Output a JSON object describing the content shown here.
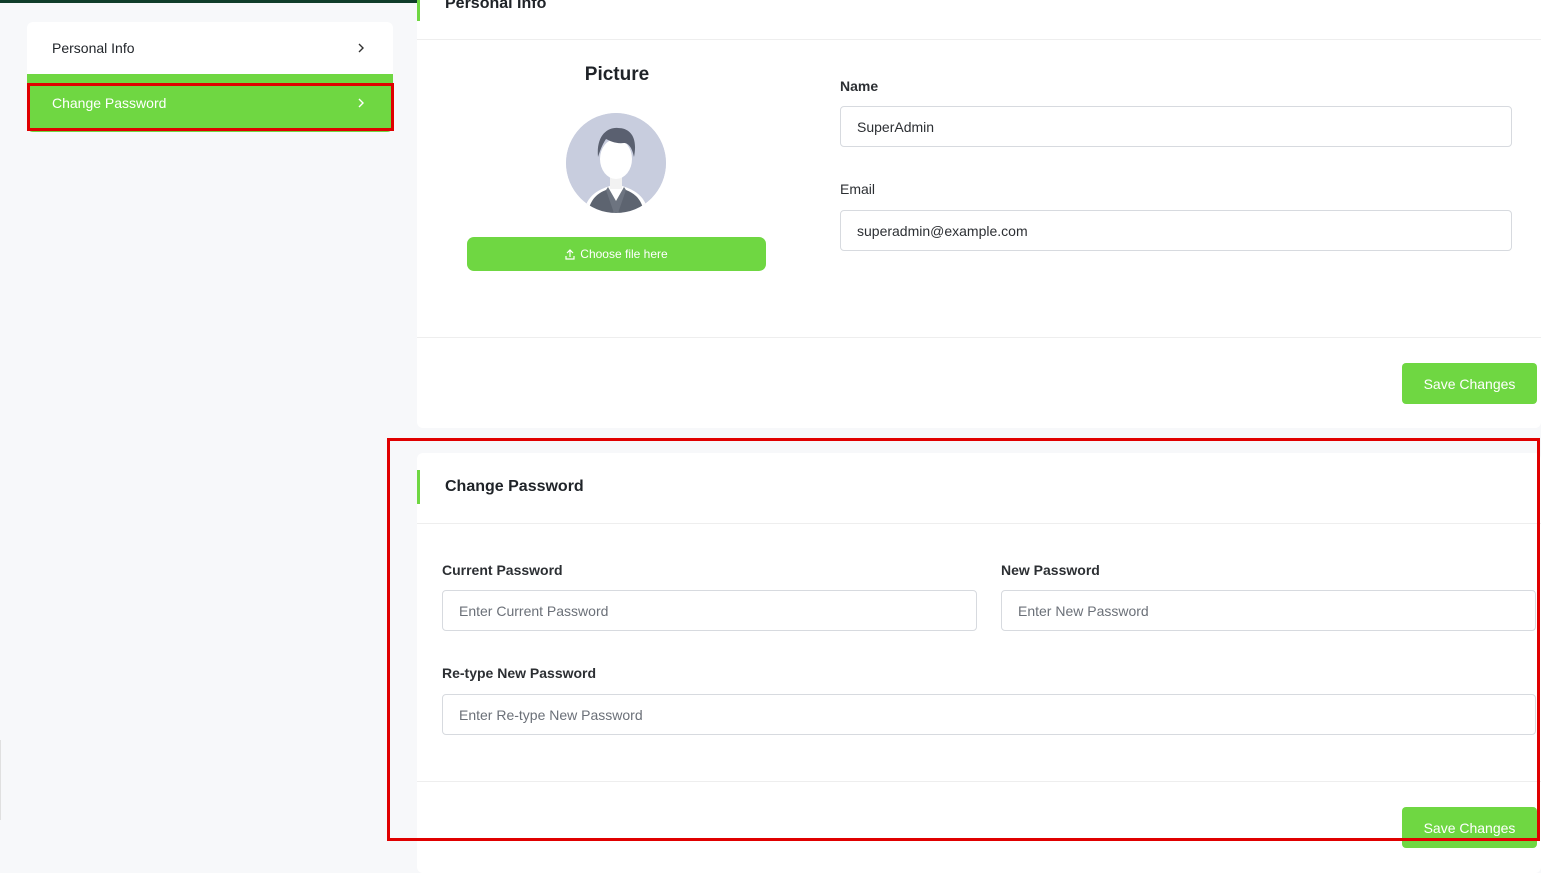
{
  "sidebar": {
    "items": [
      {
        "label": "Personal Info",
        "chevron": "chevron-right-icon"
      },
      {
        "label": "Change Password",
        "chevron": "chevron-right-icon"
      }
    ]
  },
  "personal": {
    "title": "Personal Info",
    "picture_title": "Picture",
    "choose_file_label": "Choose file here",
    "name_label": "Name",
    "name_value": "SuperAdmin",
    "email_label": "Email",
    "email_value": "superadmin@example.com",
    "save_label": "Save Changes"
  },
  "password": {
    "title": "Change Password",
    "current_label": "Current Password",
    "current_placeholder": "Enter Current Password",
    "new_label": "New Password",
    "new_placeholder": "Enter New Password",
    "retype_label": "Re-type New Password",
    "retype_placeholder": "Enter Re-type New Password",
    "save_label": "Save Changes"
  },
  "colors": {
    "accent": "#6fd742",
    "highlight": "#e00000",
    "top_bar": "#0f3d2a"
  }
}
